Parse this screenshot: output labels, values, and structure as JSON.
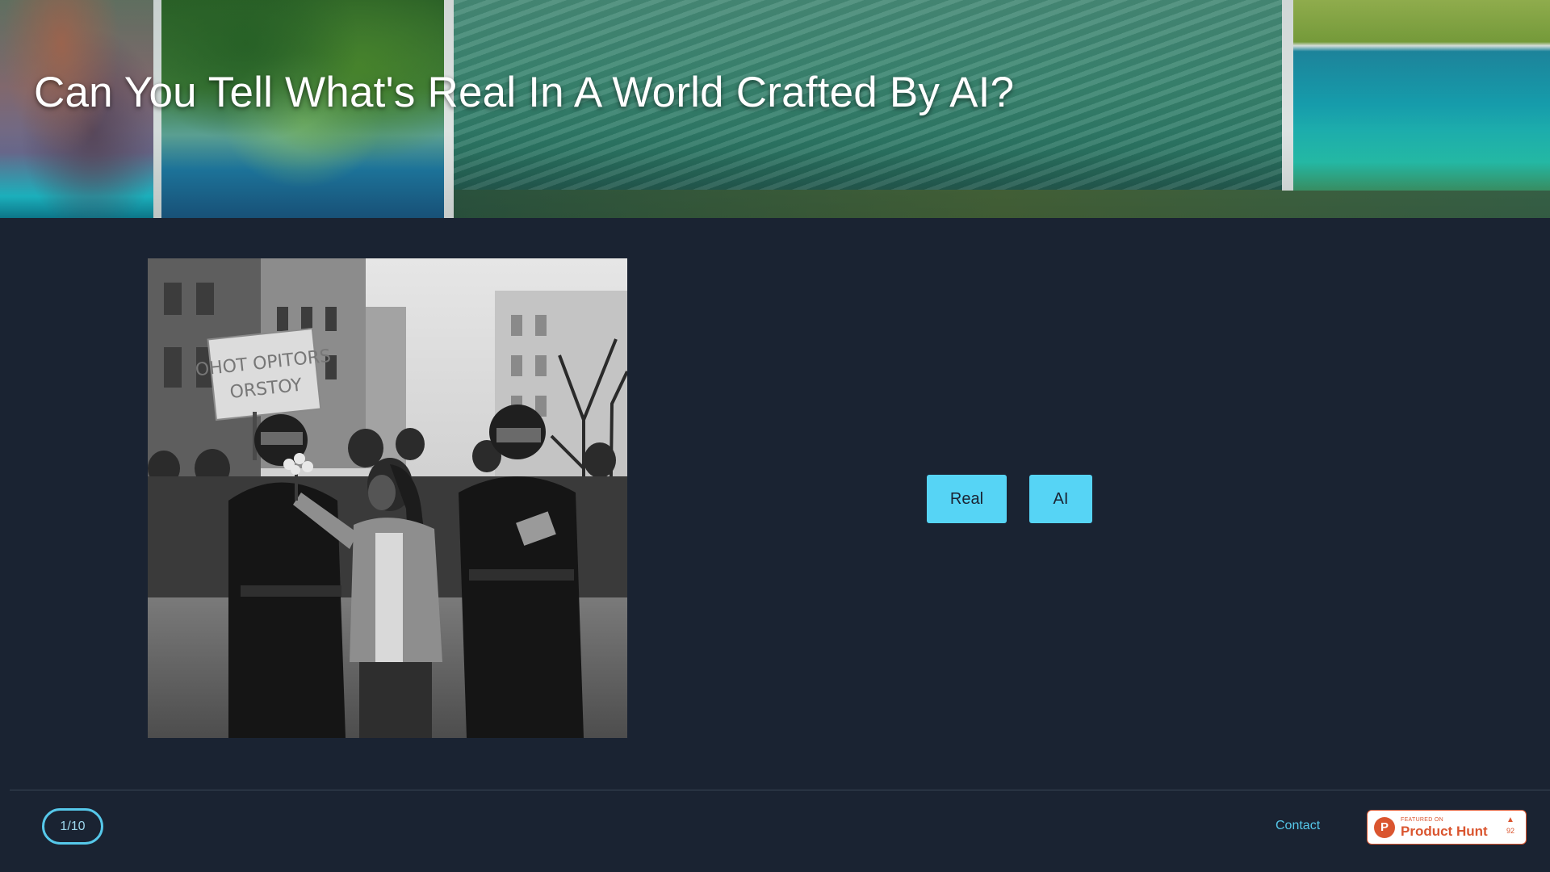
{
  "header": {
    "title": "Can You Tell What's Real In A World Crafted By AI?"
  },
  "quiz": {
    "answers": {
      "real_label": "Real",
      "ai_label": "AI"
    },
    "image_sign_text": "OHOT OPITORS ORSTOY"
  },
  "footer": {
    "progress": "1/10",
    "progress_current": 1,
    "progress_total": 10,
    "contact_label": "Contact",
    "product_hunt": {
      "featured_label": "FEATURED ON",
      "name": "Product Hunt",
      "votes": "92",
      "logo_letter": "P",
      "arrow_icon": "upvote-triangle-icon"
    }
  },
  "colors": {
    "background": "#1a2332",
    "accent": "#56d4f5",
    "counter_border": "#56c8ea",
    "product_hunt": "#da552f"
  }
}
